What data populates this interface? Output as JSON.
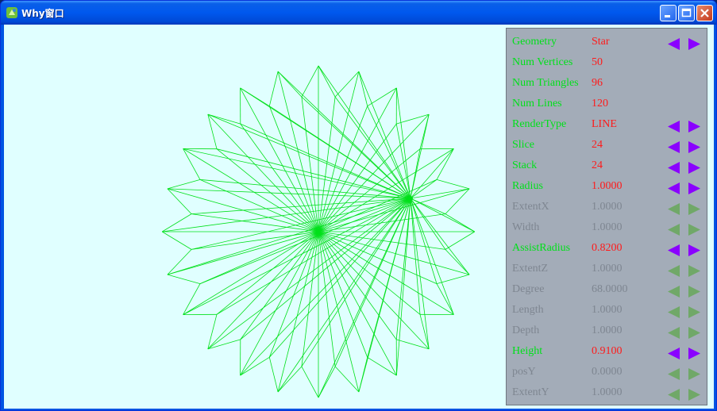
{
  "window": {
    "title": "Why窗口"
  },
  "titlebar_buttons": [
    "minimize",
    "maximize",
    "close"
  ],
  "colors": {
    "wire": "#00e01a",
    "enabled_label": "#00e01a",
    "value": "#ff1a1a",
    "disabled": "#7e8691",
    "arrow_active": "#8a00ff",
    "arrow_disabled": "#70a868",
    "panel_bg": "#a3acb8",
    "canvas_bg": "#e0ffff"
  },
  "panel": {
    "rows": [
      {
        "label": "Geometry",
        "value": "Star",
        "enabled": true,
        "arrows": true
      },
      {
        "label": "Num Vertices",
        "value": "50",
        "enabled": true,
        "arrows": false
      },
      {
        "label": "Num Triangles",
        "value": "96",
        "enabled": true,
        "arrows": false
      },
      {
        "label": "Num Lines",
        "value": "120",
        "enabled": true,
        "arrows": false
      },
      {
        "label": "RenderType",
        "value": "LINE",
        "enabled": true,
        "arrows": true
      },
      {
        "label": "Slice",
        "value": "24",
        "enabled": true,
        "arrows": true
      },
      {
        "label": "Stack",
        "value": "24",
        "enabled": true,
        "arrows": true
      },
      {
        "label": "Radius",
        "value": "1.0000",
        "enabled": true,
        "arrows": true
      },
      {
        "label": "ExtentX",
        "value": "1.0000",
        "enabled": false,
        "arrows": true
      },
      {
        "label": "Width",
        "value": "1.0000",
        "enabled": false,
        "arrows": true
      },
      {
        "label": "AssistRadius",
        "value": "0.8200",
        "enabled": true,
        "arrows": true
      },
      {
        "label": "ExtentZ",
        "value": "1.0000",
        "enabled": false,
        "arrows": true
      },
      {
        "label": "Degree",
        "value": "68.0000",
        "enabled": false,
        "arrows": true
      },
      {
        "label": "Length",
        "value": "1.0000",
        "enabled": false,
        "arrows": true
      },
      {
        "label": "Depth",
        "value": "1.0000",
        "enabled": false,
        "arrows": true
      },
      {
        "label": "Height",
        "value": "0.9100",
        "enabled": true,
        "arrows": true
      },
      {
        "label": "posY",
        "value": "0.0000",
        "enabled": false,
        "arrows": true
      },
      {
        "label": "ExtentY",
        "value": "1.0000",
        "enabled": false,
        "arrows": true
      }
    ]
  }
}
